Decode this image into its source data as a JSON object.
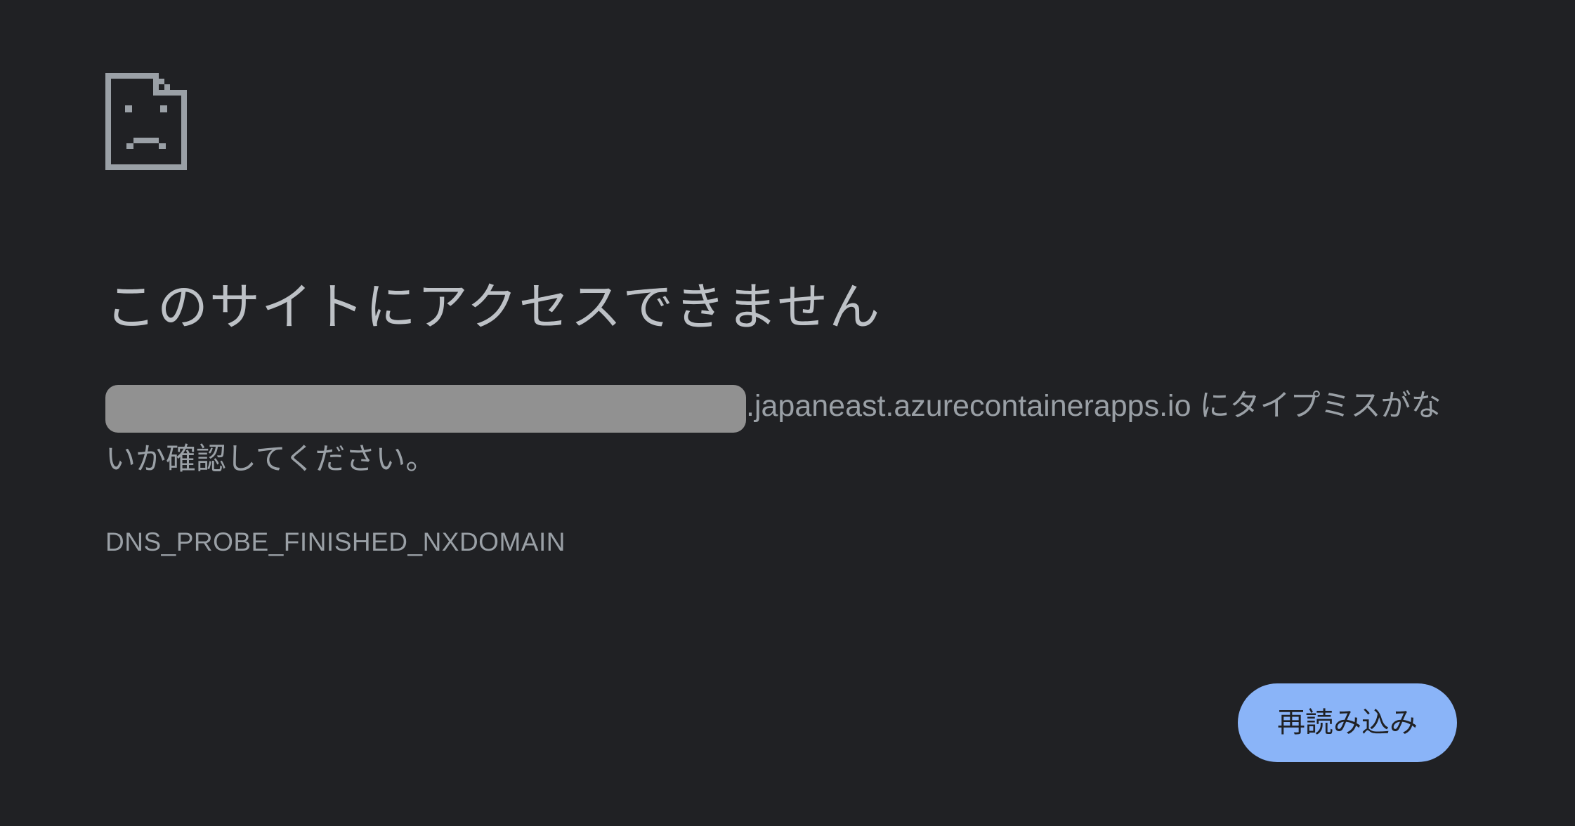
{
  "error": {
    "icon": "sad-document-icon",
    "headline": "このサイトにアクセスできません",
    "host_suffix": ".japaneast.azurecontainerapps.io",
    "message_tail": " にタイプミスがないか確認してください。",
    "code": "DNS_PROBE_FINISHED_NXDOMAIN"
  },
  "actions": {
    "reload_label": "再読み込み"
  },
  "colors": {
    "background": "#202124",
    "headline": "#bdc1c6",
    "body_text": "#9aa0a6",
    "redaction": "#919191",
    "button": "#8ab4f8",
    "button_text": "#202124"
  }
}
